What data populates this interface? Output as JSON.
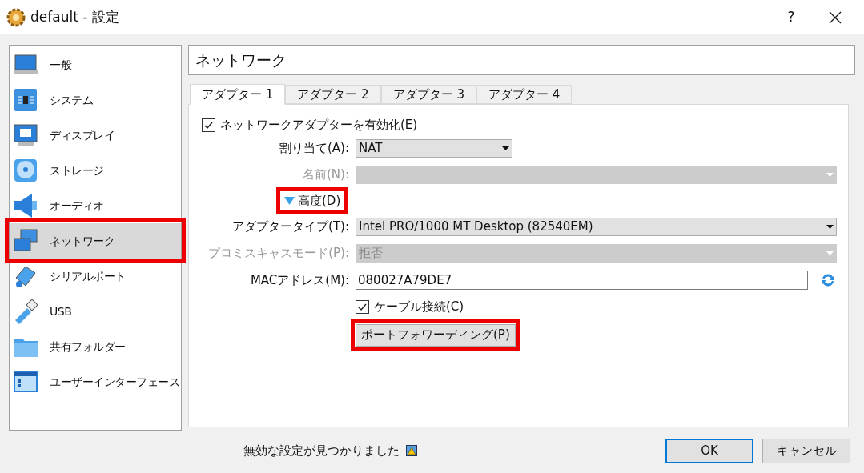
{
  "window": {
    "title": "default - 設定",
    "help": "?"
  },
  "sidebar": {
    "items": [
      {
        "label": "一般",
        "selected": false,
        "highlighted": false
      },
      {
        "label": "システム",
        "selected": false,
        "highlighted": false
      },
      {
        "label": "ディスプレイ",
        "selected": false,
        "highlighted": false
      },
      {
        "label": "ストレージ",
        "selected": false,
        "highlighted": false
      },
      {
        "label": "オーディオ",
        "selected": false,
        "highlighted": false
      },
      {
        "label": "ネットワーク",
        "selected": true,
        "highlighted": true
      },
      {
        "label": "シリアルポート",
        "selected": false,
        "highlighted": false
      },
      {
        "label": "USB",
        "selected": false,
        "highlighted": false
      },
      {
        "label": "共有フォルダー",
        "selected": false,
        "highlighted": false
      },
      {
        "label": "ユーザーインターフェース",
        "selected": false,
        "highlighted": false
      }
    ]
  },
  "page_title": "ネットワーク",
  "tabs": [
    {
      "label": "アダプター 1",
      "selected": true
    },
    {
      "label": "アダプター 2",
      "selected": false
    },
    {
      "label": "アダプター 3",
      "selected": false
    },
    {
      "label": "アダプター 4",
      "selected": false
    }
  ],
  "enable_adapter": {
    "label": "ネットワークアダプターを有効化(E)",
    "checked": true
  },
  "attached_to": {
    "label": "割り当て(A):",
    "value": "NAT",
    "disabled": false
  },
  "name": {
    "label": "名前(N):",
    "disabled": true
  },
  "advanced": {
    "label": "高度(D)",
    "expanded": true,
    "highlighted": true
  },
  "adapter_type": {
    "label": "アダプタータイプ(T):",
    "value": "Intel PRO/1000 MT Desktop (82540EM)",
    "disabled": false
  },
  "promiscuous": {
    "label": "プロミスキャスモード(P):",
    "value": "拒否",
    "disabled": true
  },
  "mac": {
    "label": "MACアドレス(M):",
    "value": "080027A79DE7"
  },
  "cable": {
    "label": "ケーブル接続(C)",
    "checked": true
  },
  "port_forwarding": {
    "label": "ポートフォワーディング(P)",
    "highlighted": true
  },
  "status": "無効な設定が見つかりました",
  "buttons": [
    {
      "label": "OK",
      "default": true
    },
    {
      "label": "キャンセル",
      "default": false
    }
  ]
}
